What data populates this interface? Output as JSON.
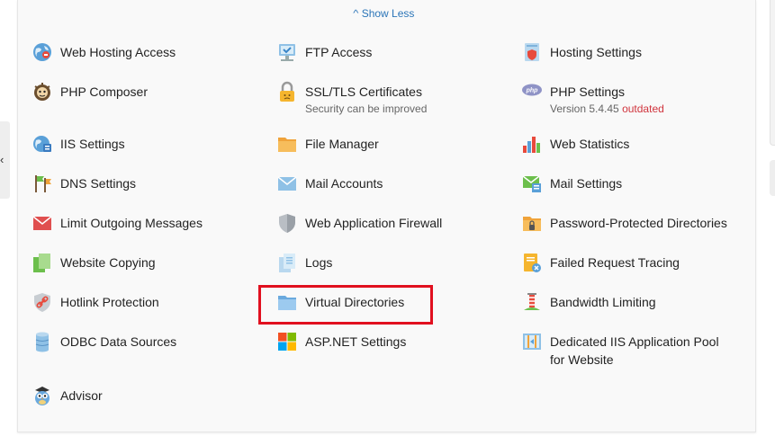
{
  "show_less": {
    "label": "Show Less",
    "icon": "chevron-up-icon"
  },
  "tools": [
    {
      "id": "web-hosting-access",
      "label": "Web Hosting Access",
      "icon": "globe-icon"
    },
    {
      "id": "ftp-access",
      "label": "FTP Access",
      "icon": "ftp-icon"
    },
    {
      "id": "hosting-settings",
      "label": "Hosting Settings",
      "icon": "hosting-settings-icon"
    },
    {
      "id": "php-composer",
      "label": "PHP Composer",
      "icon": "composer-icon"
    },
    {
      "id": "ssl-tls-certificates",
      "label": "SSL/TLS Certificates",
      "sub": "Security can be improved",
      "icon": "lock-icon"
    },
    {
      "id": "php-settings",
      "label": "PHP Settings",
      "sub_version": "Version 5.4.45",
      "sub_status": "outdated",
      "icon": "php-icon"
    },
    {
      "id": "iis-settings",
      "label": "IIS Settings",
      "icon": "iis-icon"
    },
    {
      "id": "file-manager",
      "label": "File Manager",
      "icon": "folder-icon"
    },
    {
      "id": "web-statistics",
      "label": "Web Statistics",
      "icon": "bar-chart-icon"
    },
    {
      "id": "dns-settings",
      "label": "DNS Settings",
      "icon": "dns-flags-icon"
    },
    {
      "id": "mail-accounts",
      "label": "Mail Accounts",
      "icon": "envelope-icon"
    },
    {
      "id": "mail-settings",
      "label": "Mail Settings",
      "icon": "mail-settings-icon"
    },
    {
      "id": "limit-outgoing-messages",
      "label": "Limit Outgoing Messages",
      "icon": "red-envelope-icon"
    },
    {
      "id": "web-application-firewall",
      "label": "Web Application Firewall",
      "icon": "shield-icon"
    },
    {
      "id": "password-protected-directories",
      "label": "Password-Protected Directories",
      "icon": "locked-folder-icon"
    },
    {
      "id": "website-copying",
      "label": "Website Copying",
      "icon": "copy-pages-icon"
    },
    {
      "id": "logs",
      "label": "Logs",
      "icon": "log-pages-icon"
    },
    {
      "id": "failed-request-tracing",
      "label": "Failed Request Tracing",
      "icon": "failed-trace-icon"
    },
    {
      "id": "hotlink-protection",
      "label": "Hotlink Protection",
      "icon": "hotlink-shield-icon"
    },
    {
      "id": "virtual-directories",
      "label": "Virtual Directories",
      "icon": "blue-folder-icon"
    },
    {
      "id": "bandwidth-limiting",
      "label": "Bandwidth Limiting",
      "icon": "bandwidth-icon"
    },
    {
      "id": "odbc-data-sources",
      "label": "ODBC Data Sources",
      "icon": "database-icon"
    },
    {
      "id": "aspnet-settings",
      "label": "ASP.NET Settings",
      "icon": "windows-logo-icon"
    },
    {
      "id": "dedicated-iis-pool",
      "label": "Dedicated IIS Application Pool",
      "label2": "for Website",
      "icon": "app-pool-icon"
    },
    {
      "id": "advisor",
      "label": "Advisor",
      "icon": "owl-icon"
    }
  ],
  "colors": {
    "link": "#2b75b8",
    "warning": "#d0343d",
    "highlight": "#e1101f"
  }
}
